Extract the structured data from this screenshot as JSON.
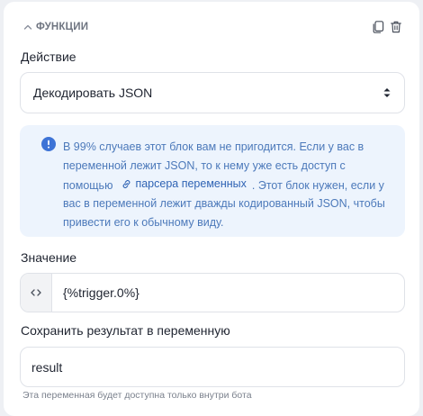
{
  "section": {
    "title": "ФУНКЦИИ"
  },
  "action": {
    "label": "Действие",
    "selected": "Декодировать JSON"
  },
  "info": {
    "text_before": "В 99% случаев этот блок вам не пригодится. Если у вас в переменной лежит JSON, то к нему уже есть доступ с помощью",
    "link_label": "парсера переменных",
    "text_after": ". Этот блок нужен, если у вас в переменной лежит дважды кодированный JSON, чтобы привести его к обычному виду."
  },
  "value": {
    "label": "Значение",
    "input_value": "{%trigger.0%}"
  },
  "result": {
    "label": "Сохранить результат в переменную",
    "input_value": "result",
    "hint": "Эта переменная будет доступна только внутри бота"
  },
  "colors": {
    "info_bg": "#edf4fd",
    "info_text": "#4c79ba",
    "info_icon": "#3d73d6",
    "border": "#dfe2e8"
  }
}
